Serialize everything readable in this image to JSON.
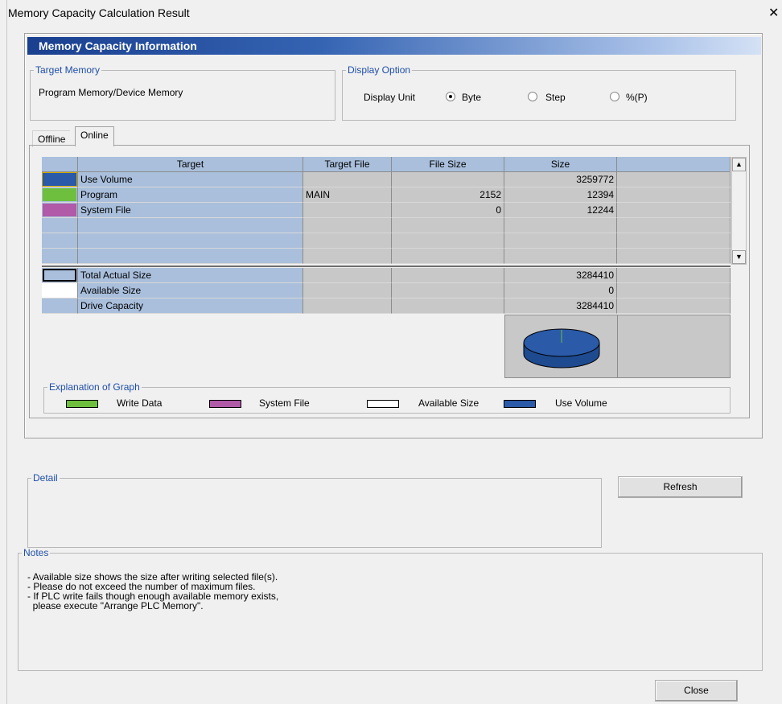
{
  "window": {
    "title": "Memory Capacity Calculation Result",
    "close_glyph": "✕"
  },
  "panel_header": "Memory Capacity Information",
  "target_memory": {
    "legend": "Target Memory",
    "value": "Program Memory/Device Memory"
  },
  "display_option": {
    "legend": "Display Option",
    "unit_label": "Display Unit",
    "options": [
      {
        "label": "Byte",
        "checked": true
      },
      {
        "label": "Step",
        "checked": false
      },
      {
        "label": "%(P)",
        "checked": false
      }
    ]
  },
  "tabs": [
    "Offline",
    "Online"
  ],
  "active_tab": "Online",
  "table": {
    "headers": [
      "",
      "Target",
      "Target File",
      "File Size",
      "Size",
      ""
    ],
    "rows": [
      {
        "color": "#2a5aa8",
        "target": "Use Volume",
        "file": "",
        "file_size": "",
        "size": "3259772"
      },
      {
        "color": "#6fbf3f",
        "target": "Program",
        "file": "MAIN",
        "file_size": "2152",
        "size": "12394"
      },
      {
        "color": "#b05aa8",
        "target": "System File",
        "file": "",
        "file_size": "0",
        "size": "12244"
      },
      {
        "color": "",
        "target": "",
        "file": "",
        "file_size": "",
        "size": ""
      },
      {
        "color": "",
        "target": "",
        "file": "",
        "file_size": "",
        "size": ""
      },
      {
        "color": "",
        "target": "",
        "file": "",
        "file_size": "",
        "size": ""
      }
    ],
    "summary": [
      {
        "color": "#a9bfdc",
        "target": "Total Actual Size",
        "size": "3284410"
      },
      {
        "color": "#ffffff",
        "target": "Available Size",
        "size": "0"
      },
      {
        "color": "#a9bfdc",
        "target": "Drive Capacity",
        "size": "3284410"
      }
    ]
  },
  "pie": {
    "use_volume_color": "#2a5aa8",
    "used_fraction": 1.0
  },
  "graph_legend": {
    "legend": "Explanation of Graph",
    "items": [
      {
        "label": "Write Data",
        "color": "#6fbf3f"
      },
      {
        "label": "System File",
        "color": "#b05aa8"
      },
      {
        "label": "Available Size",
        "color": "#ffffff"
      },
      {
        "label": "Use Volume",
        "color": "#2a5aa8"
      }
    ]
  },
  "detail": {
    "legend": "Detail"
  },
  "refresh_label": "Refresh",
  "notes": {
    "legend": "Notes",
    "lines": [
      "- Available size shows the size after writing selected file(s).",
      "- Please do not exceed the number of maximum files.",
      "- If PLC write fails though enough available memory exists,",
      "  please execute \"Arrange PLC Memory\"."
    ]
  },
  "close_label": "Close",
  "colors": {
    "accent": "#1f4ea8",
    "header_start": "#1a3f8f",
    "grid_blue": "#a9bfdc",
    "grid_gray": "#c8c8c8"
  }
}
